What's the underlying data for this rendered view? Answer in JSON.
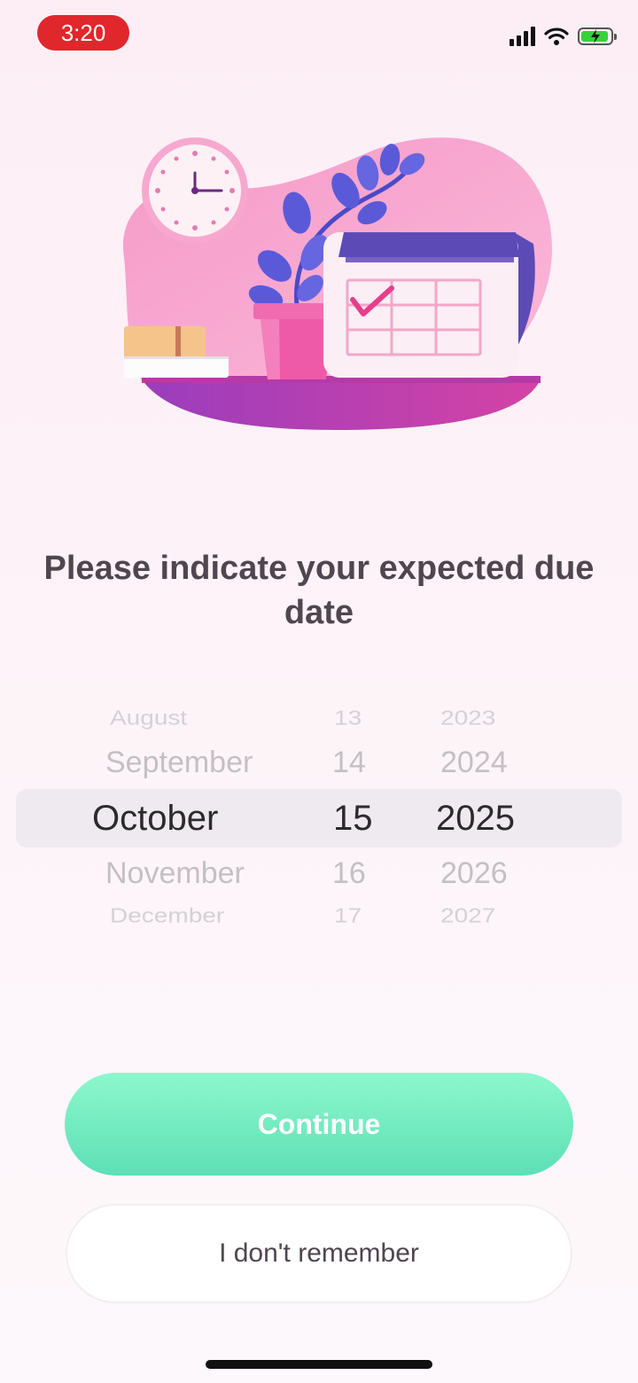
{
  "status_bar": {
    "time": "3:20",
    "icons": [
      "signal-icon",
      "wifi-icon",
      "battery-charging-icon"
    ]
  },
  "illustration": {
    "name": "calendar-illustration",
    "colors": {
      "blob": "#f7a6d0",
      "table": "#c13aa0",
      "calendar_top": "#5c4bb6",
      "check": "#e53f8b",
      "leaves": "#5a5ad8",
      "pot": "#ee5aa8",
      "books": "#f5c48a"
    }
  },
  "title": "Please indicate your expected due date",
  "picker": {
    "months": [
      "August",
      "September",
      "October",
      "November",
      "December"
    ],
    "days": [
      "13",
      "14",
      "15",
      "16",
      "17"
    ],
    "years": [
      "2023",
      "2024",
      "2025",
      "2026",
      "2027"
    ],
    "selected": {
      "month": "October",
      "day": "15",
      "year": "2025"
    }
  },
  "buttons": {
    "continue": "Continue",
    "dont_remember": "I don't remember"
  },
  "colors": {
    "accent_green": "#5ddfb5",
    "status_red": "#e0272c",
    "text": "#4f4650"
  }
}
